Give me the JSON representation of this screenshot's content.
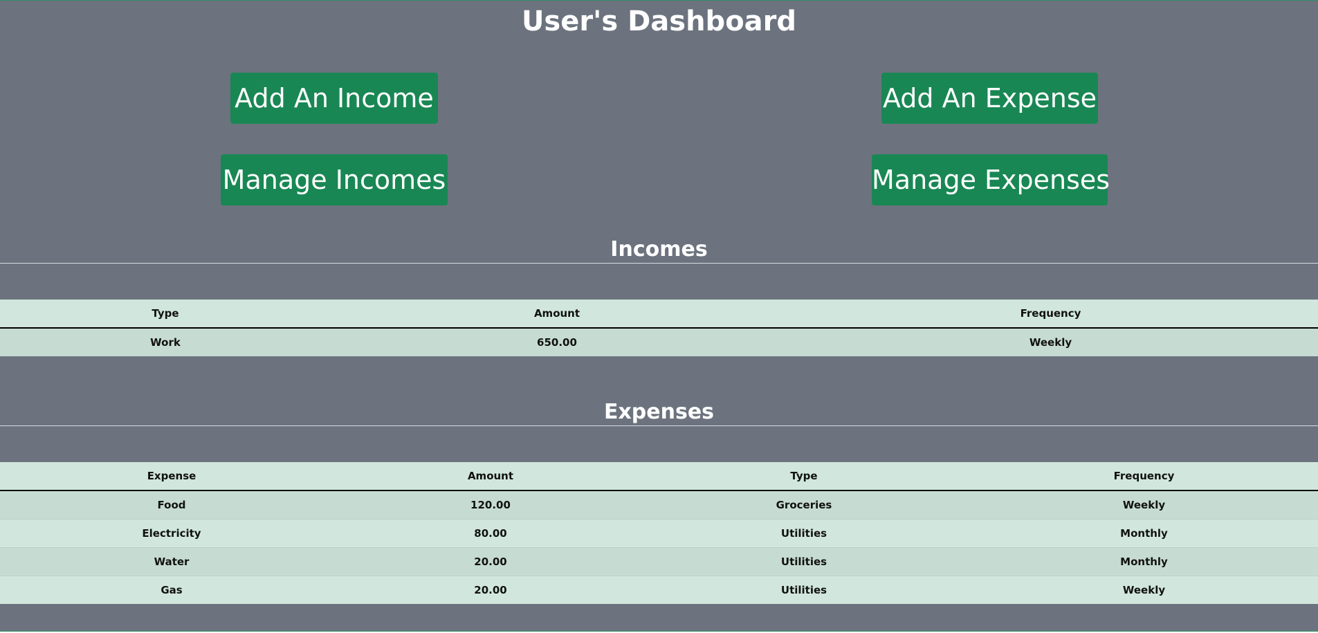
{
  "page": {
    "title": "User's Dashboard"
  },
  "actions": {
    "add_income": "Add An Income",
    "manage_incomes": "Manage Incomes",
    "add_expense": "Add An Expense",
    "manage_expenses": "Manage Expenses"
  },
  "incomes": {
    "heading": "Incomes",
    "columns": [
      "Type",
      "Amount",
      "Frequency"
    ],
    "rows": [
      [
        "Work",
        "650.00",
        "Weekly"
      ]
    ]
  },
  "expenses": {
    "heading": "Expenses",
    "columns": [
      "Expense",
      "Amount",
      "Type",
      "Frequency"
    ],
    "rows": [
      [
        "Food",
        "120.00",
        "Groceries",
        "Weekly"
      ],
      [
        "Electricity",
        "80.00",
        "Utilities",
        "Monthly"
      ],
      [
        "Water",
        "20.00",
        "Utilities",
        "Monthly"
      ],
      [
        "Gas",
        "20.00",
        "Utilities",
        "Weekly"
      ]
    ]
  },
  "colors": {
    "background": "#6c737e",
    "button": "#198754",
    "table_header": "#d1e7dd",
    "table_row_alt": "#c6dcd2"
  }
}
